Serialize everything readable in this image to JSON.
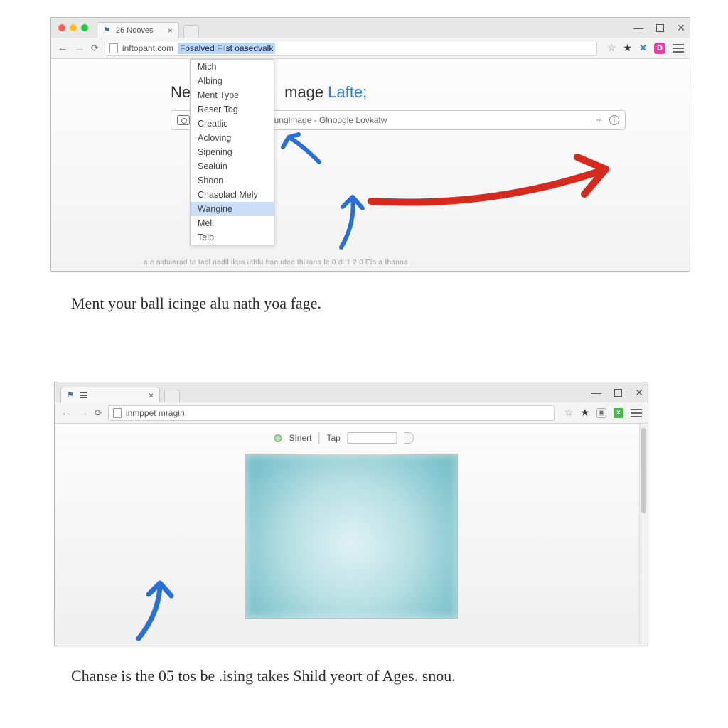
{
  "browser1": {
    "tab": {
      "title": "26 Nooves"
    },
    "window_controls": {
      "min": "—",
      "max": "▢",
      "close": "✕"
    },
    "address": {
      "domain": "inftopant.com",
      "highlight": "Fosalved Filst oasedvalk"
    },
    "page": {
      "title_left": "Ne",
      "title_mid": "mage",
      "title_accent": "Lafte;"
    },
    "searchbar": {
      "text": "ounglmage - Glnoogle Lovkatw"
    },
    "autocomplete": {
      "items": [
        "Mich",
        "Albing",
        "Ment Type",
        "Reser Tog",
        "Creatlic",
        "Acloving",
        "Sipening",
        "Sealuin",
        "Shoon",
        "Chasolacl Mely",
        "Wangine",
        "Mell",
        "Telp"
      ],
      "highlight_index": 10
    },
    "footer": "a   e  niduiarad te tadl   nadil ikua      uthlu  hanudee thikana  le               0 di 1 2 0  Elo a thanna"
  },
  "caption1": "Ment your ball icinge alu nath yoa fage.",
  "browser2": {
    "tab": {
      "title": ""
    },
    "address": {
      "text": "inmppet mragin"
    },
    "mini": {
      "label1": "SInert",
      "label2": "Tap"
    }
  },
  "caption2": "Chanse is the 05 tos be .ising takes Shild yeort of Ages. snou.",
  "icons": {
    "ext_blue": "✕",
    "ext_pink": "D",
    "ext_green": "x",
    "info": "i",
    "plus": "+"
  },
  "colors": {
    "link_blue": "#2a7de1",
    "highlight_bg": "#c9def6",
    "red_arrow": "#d62a1f",
    "blue_arrow": "#2a6fd6"
  }
}
